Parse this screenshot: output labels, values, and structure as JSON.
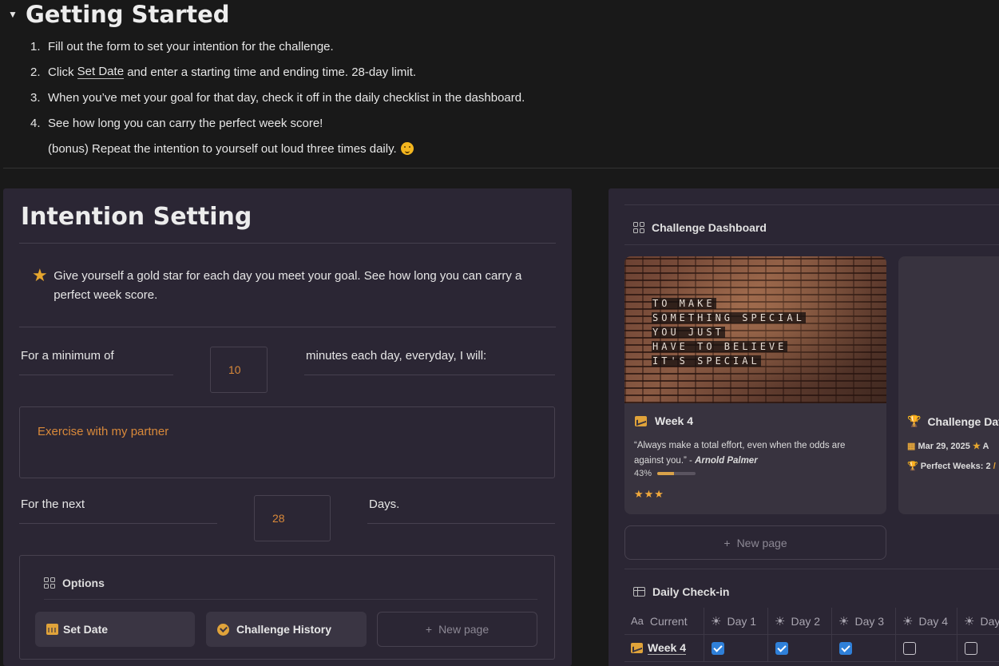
{
  "getting_started": {
    "title": "Getting Started",
    "steps": [
      {
        "num": "1.",
        "text": "Fill out the form to set your intention for the challenge."
      },
      {
        "num": "2.",
        "pre": "Click ",
        "link": "Set Date",
        "post": " and enter a starting time and ending time. 28-day limit."
      },
      {
        "num": "3.",
        "text": "When you’ve met your goal for that day, check it off in the daily checklist in the dashboard."
      },
      {
        "num": "4.",
        "text": "See how long you can carry the perfect week score!"
      }
    ],
    "bonus": "(bonus) Repeat the intention to yourself out loud three times daily."
  },
  "intention": {
    "title": "Intention Setting",
    "callout": "Give yourself a gold star for each day you meet your goal. See how long you can carry a perfect week score.",
    "min_label": "For a minimum of",
    "minutes_value": "10",
    "minutes_label": "minutes each day, everyday, I will:",
    "intention_value": "Exercise with my partner",
    "next_label": "For the next",
    "days_value": "28",
    "days_label": "Days.",
    "options": {
      "heading": "Options",
      "set_date": "Set Date",
      "history": "Challenge History",
      "new_page": "New page"
    }
  },
  "dashboard": {
    "heading": "Challenge Dashboard",
    "card1": {
      "image_text": [
        "TO MAKE",
        "SOMETHING SPECIAL",
        "YOU JUST",
        "HAVE TO BELIEVE",
        "IT'S SPECIAL"
      ],
      "title": "Week 4",
      "quote": "“Always make a total effort, even when the odds are against you.” - ",
      "author": "Arnold Palmer",
      "progress_label": "43%",
      "progress_value": 0.43,
      "stars": "★★★"
    },
    "card2": {
      "title": "Challenge Dat",
      "date_line": "Mar 29, 2025",
      "date_suffix": "A",
      "weeks_line": "Perfect Weeks: 2",
      "weeks_suffix": "/"
    },
    "new_page": "New page"
  },
  "checkin": {
    "heading": "Daily Check-in",
    "columns": [
      "Current",
      "Day 1",
      "Day 2",
      "Day 3",
      "Day 4",
      "Day"
    ],
    "row": {
      "name": "Week 4",
      "checks": [
        true,
        true,
        true,
        false,
        false
      ]
    }
  },
  "colors": {
    "accent": "#e0a33a",
    "checkbox_blue": "#2f80d9",
    "panel": "#2b2634",
    "background": "#191919"
  }
}
